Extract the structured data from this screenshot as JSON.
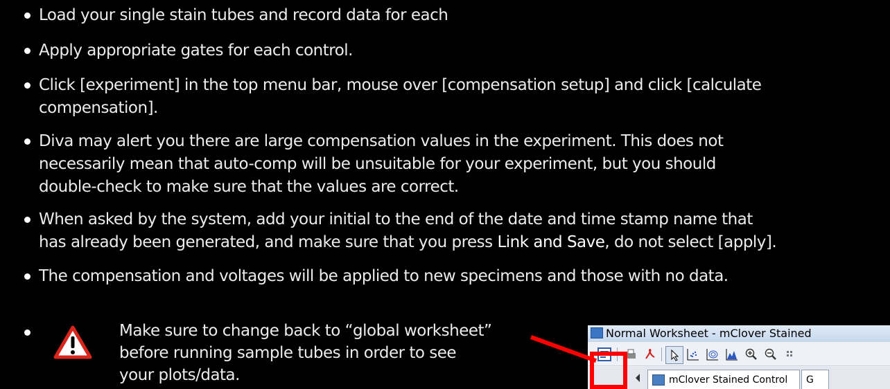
{
  "bullets": [
    {
      "text": "Load your single stain tubes and record data for each"
    },
    {
      "text": "Apply appropriate gates for each control."
    },
    {
      "line1": "Click [experiment] in the top menu bar, mouse over [compensation setup] and click [calculate",
      "line2": "compensation]."
    },
    {
      "line1": "Diva may alert you there are large compensation values in the experiment. This does not",
      "line2": "necessarily mean that auto-comp will be unsuitable for your experiment, but you should",
      "line3": "double-check to make sure that the values are correct."
    },
    {
      "line1": "When asked by the system, add your initial to the end of the date and time stamp name that",
      "line2_pre": "has already been generated, and make sure that you press ",
      "line2_bold": "Link and Save",
      "line2_post": ", do not select [apply]."
    },
    {
      "text": "The compensation and voltages will be applied to new specimens and those with no data."
    }
  ],
  "warning": {
    "icon": "warning-triangle-icon",
    "line1": "Make sure to change back to “global worksheet”",
    "line2": "before running sample tubes in order to see",
    "line3": "your plots/data."
  },
  "inset": {
    "window_title": "Normal Worksheet - mClover Stained",
    "tab_label": "mClover Stained Control",
    "tab_next": "G"
  },
  "colors": {
    "background": "#000000",
    "text": "#ffffff",
    "highlight": "#ff0000"
  }
}
